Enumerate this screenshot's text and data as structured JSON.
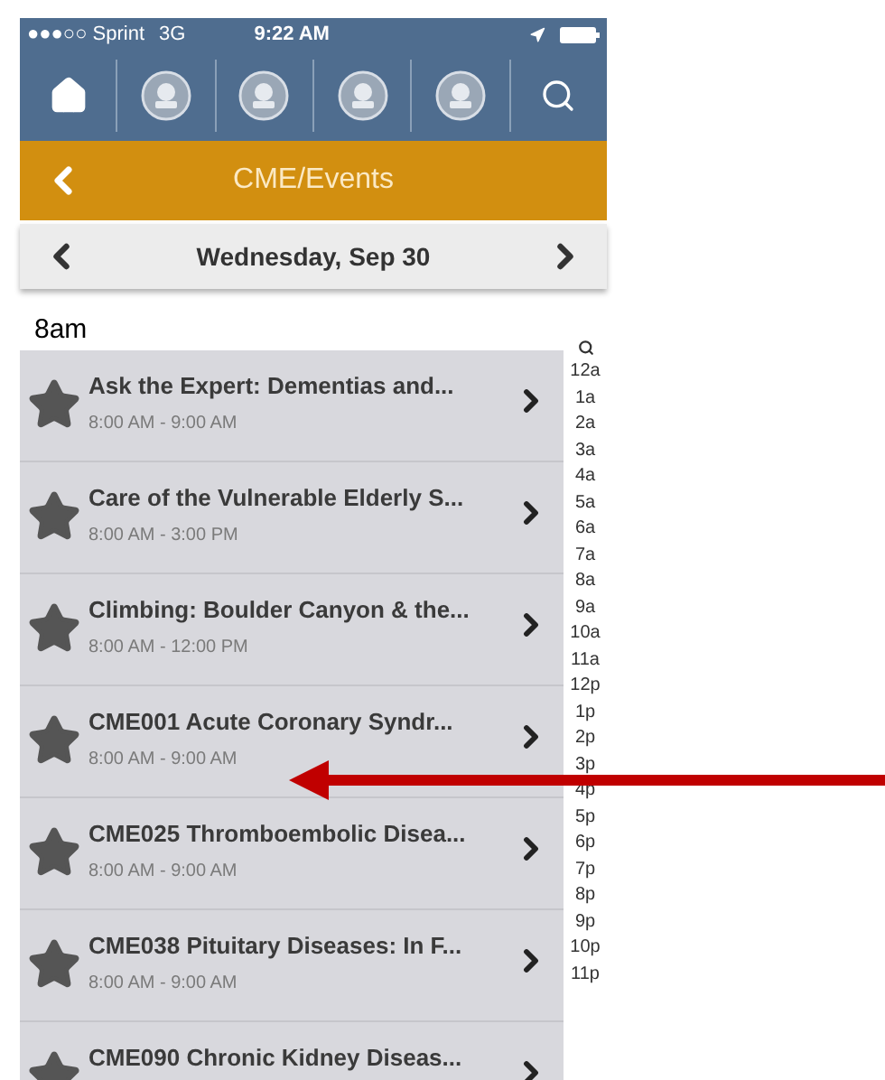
{
  "status_bar": {
    "carrier": "●●●○○ Sprint",
    "network": "3G",
    "time": "9:22 AM"
  },
  "header": {
    "title": "CME/Events"
  },
  "date_bar": {
    "date": "Wednesday, Sep 30"
  },
  "section": {
    "label": "8am"
  },
  "events": [
    {
      "title": "Ask the Expert: Dementias and...",
      "time": "8:00 AM - 9:00 AM",
      "starred": true
    },
    {
      "title": "Care of the Vulnerable Elderly S...",
      "time": "8:00 AM - 3:00 PM",
      "starred": true
    },
    {
      "title": "Climbing: Boulder Canyon & the...",
      "time": "8:00 AM - 12:00 PM",
      "starred": true
    },
    {
      "title": "CME001 Acute Coronary Syndr...",
      "time": "8:00 AM - 9:00 AM",
      "starred": true
    },
    {
      "title": "CME025 Thromboembolic Disea...",
      "time": "8:00 AM - 9:00 AM",
      "starred": true
    },
    {
      "title": "CME038 Pituitary Diseases: In F...",
      "time": "8:00 AM - 9:00 AM",
      "starred": true
    },
    {
      "title": "CME090 Chronic Kidney Diseas...",
      "starred": true
    }
  ],
  "hour_index": [
    "12a",
    "1a",
    "2a",
    "3a",
    "4a",
    "5a",
    "6a",
    "7a",
    "8a",
    "9a",
    "10a",
    "11a",
    "12p",
    "1p",
    "2p",
    "3p",
    "4p",
    "5p",
    "6p",
    "7p",
    "8p",
    "9p",
    "10p",
    "11p"
  ]
}
